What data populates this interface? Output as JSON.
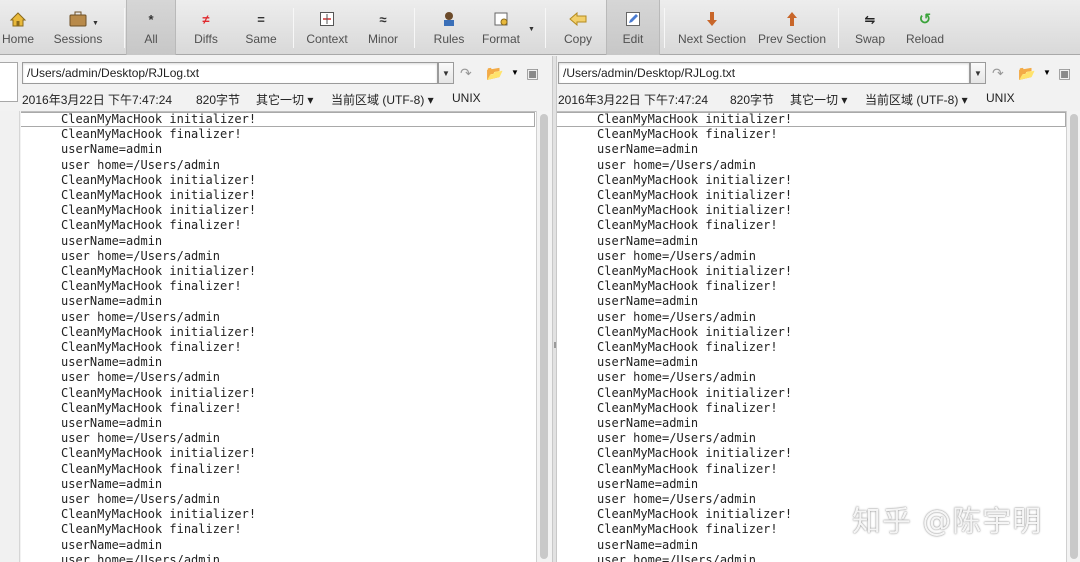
{
  "toolbar": {
    "buttons": [
      {
        "label": "Home",
        "icon": "home-icon"
      },
      {
        "label": "Sessions",
        "icon": "briefcase-icon"
      },
      {
        "label": "All",
        "icon": "asterisk-icon"
      },
      {
        "label": "Diffs",
        "icon": "not-equal-icon"
      },
      {
        "label": "Same",
        "icon": "equal-icon"
      },
      {
        "label": "Context",
        "icon": "context-icon"
      },
      {
        "label": "Minor",
        "icon": "approx-icon"
      },
      {
        "label": "Rules",
        "icon": "rules-icon"
      },
      {
        "label": "Format",
        "icon": "format-icon"
      },
      {
        "label": "Copy",
        "icon": "copy-icon"
      },
      {
        "label": "Edit",
        "icon": "edit-icon"
      },
      {
        "label": "Next Section",
        "icon": "arrow-down-icon"
      },
      {
        "label": "Prev Section",
        "icon": "arrow-up-icon"
      },
      {
        "label": "Swap",
        "icon": "swap-icon"
      },
      {
        "label": "Reload",
        "icon": "reload-icon"
      }
    ],
    "accent_colors": {
      "diffs": "#e0282d",
      "copy": "#e8b530",
      "arrows": "#c8662a",
      "reload": "#3aa33a"
    }
  },
  "left": {
    "path": "/Users/admin/Desktop/RJLog.txt",
    "datetime": "2016年3月22日 下午7:47:24",
    "size": "820字节",
    "mode": "其它一切 ▾",
    "encoding": "当前区域 (UTF-8) ▾",
    "line_endings": "UNIX"
  },
  "right": {
    "path": "/Users/admin/Desktop/RJLog.txt",
    "datetime": "2016年3月22日 下午7:47:24",
    "size": "820字节",
    "mode": "其它一切 ▾",
    "encoding": "当前区域 (UTF-8) ▾",
    "line_endings": "UNIX"
  },
  "lines": [
    "CleanMyMacHook initializer!",
    "CleanMyMacHook finalizer!",
    "userName=admin",
    "user home=/Users/admin",
    "CleanMyMacHook initializer!",
    "CleanMyMacHook initializer!",
    "CleanMyMacHook initializer!",
    "CleanMyMacHook finalizer!",
    "userName=admin",
    "user home=/Users/admin",
    "CleanMyMacHook initializer!",
    "CleanMyMacHook finalizer!",
    "userName=admin",
    "user home=/Users/admin",
    "CleanMyMacHook initializer!",
    "CleanMyMacHook finalizer!",
    "userName=admin",
    "user home=/Users/admin",
    "CleanMyMacHook initializer!",
    "CleanMyMacHook finalizer!",
    "userName=admin",
    "user home=/Users/admin",
    "CleanMyMacHook initializer!",
    "CleanMyMacHook finalizer!",
    "userName=admin",
    "user home=/Users/admin",
    "CleanMyMacHook initializer!",
    "CleanMyMacHook finalizer!",
    "userName=admin",
    "user home=/Users/admin"
  ],
  "watermark": "知乎 @陈宇明"
}
